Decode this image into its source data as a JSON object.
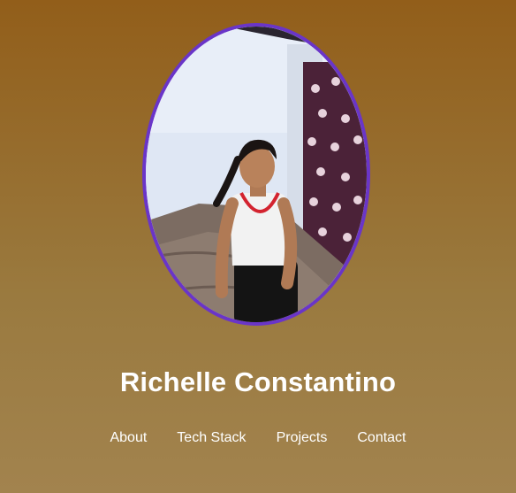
{
  "profile": {
    "name": "Richelle Constantino",
    "photo_icon": "profile-photo"
  },
  "nav": {
    "items": [
      {
        "label": "About"
      },
      {
        "label": "Tech Stack"
      },
      {
        "label": "Projects"
      },
      {
        "label": "Contact"
      }
    ]
  },
  "colors": {
    "gradient_top": "#925e1a",
    "gradient_bottom": "#a2834e",
    "avatar_border": "#6a35c8",
    "text": "#ffffff"
  }
}
